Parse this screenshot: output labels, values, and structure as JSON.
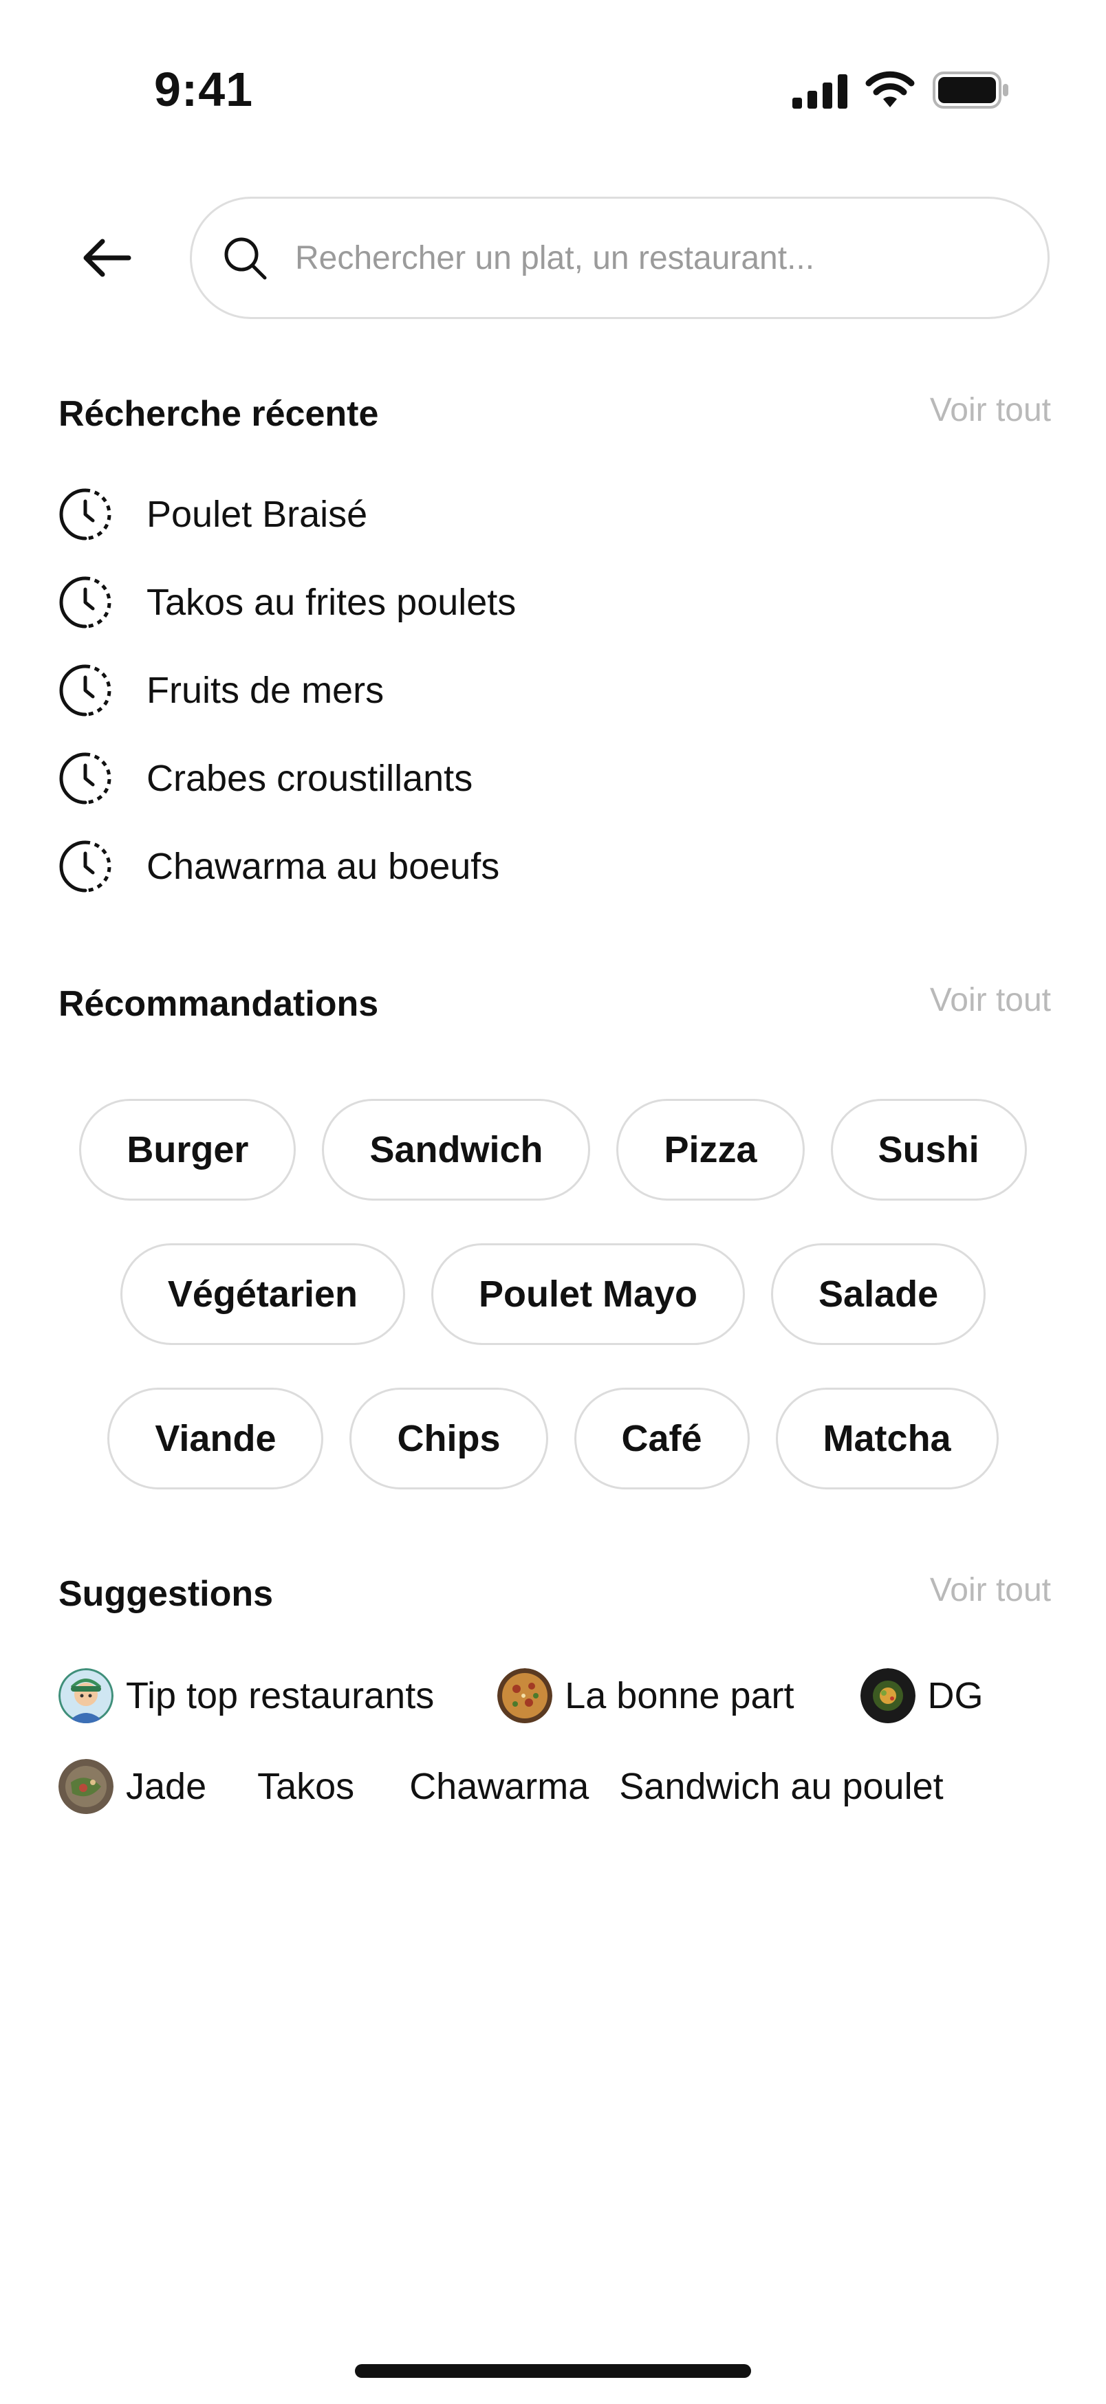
{
  "status_bar": {
    "time": "9:41"
  },
  "search": {
    "placeholder": "Rechercher un plat, un restaurant..."
  },
  "recent": {
    "title": "Récherche récente",
    "see_all": "Voir tout",
    "items": [
      {
        "label": "Poulet Braisé"
      },
      {
        "label": "Takos au frites poulets"
      },
      {
        "label": "Fruits de mers"
      },
      {
        "label": "Crabes croustillants"
      },
      {
        "label": "Chawarma au boeufs"
      }
    ]
  },
  "recommendations": {
    "title": "Récommandations",
    "see_all": "Voir tout",
    "rows": [
      [
        "Burger",
        "Sandwich",
        "Pizza",
        "Sushi"
      ],
      [
        "Végétarien",
        "Poulet Mayo",
        "Salade"
      ],
      [
        "Viande",
        "Chips",
        "Café",
        "Matcha"
      ]
    ]
  },
  "suggestions": {
    "title": "Suggestions",
    "see_all": "Voir tout",
    "items": [
      {
        "label": "Tip top restaurants",
        "icon": "avatar-person"
      },
      {
        "label": "La bonne part",
        "icon": "pizza-image"
      },
      {
        "label": "DG",
        "icon": "dish-image"
      },
      {
        "label": "Jade",
        "icon": "dish-image"
      },
      {
        "label": "Takos",
        "icon": ""
      },
      {
        "label": "Chawarma",
        "icon": ""
      },
      {
        "label": "Sandwich au poulet",
        "icon": ""
      }
    ]
  },
  "colors": {
    "text": "#111111",
    "muted": "#b9b9b9",
    "border": "#dcdcdc"
  }
}
